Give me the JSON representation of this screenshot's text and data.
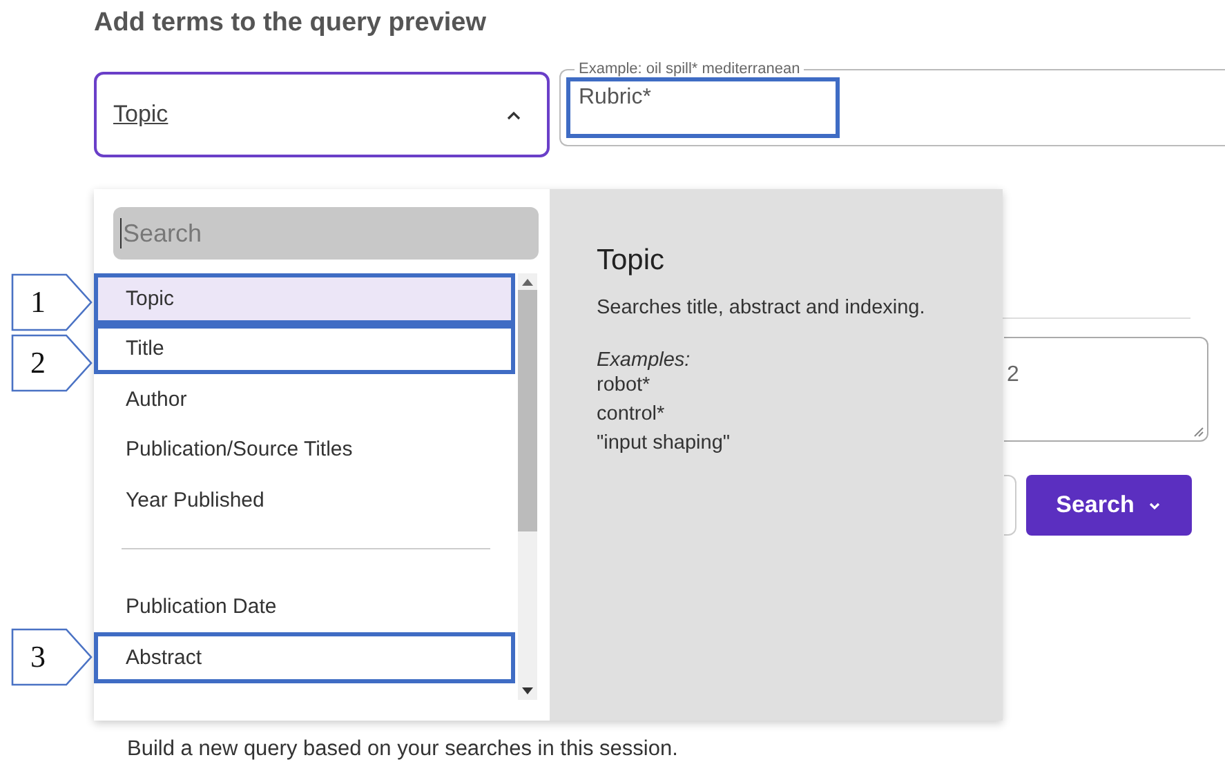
{
  "heading": "Add terms to the query preview",
  "field_select": {
    "label": "Topic",
    "expanded": true
  },
  "query_field": {
    "legend": "Example: oil spill* mediterranean",
    "value": "Rubric*",
    "highlighted": true
  },
  "dropdown": {
    "search": {
      "placeholder": "Search"
    },
    "groups": [
      {
        "items": [
          {
            "label": "Topic",
            "selected": true,
            "highlighted": true
          },
          {
            "label": "Title",
            "selected": false,
            "highlighted": true
          },
          {
            "label": "Author",
            "selected": false,
            "highlighted": false
          },
          {
            "label": "Publication/Source Titles",
            "selected": false,
            "highlighted": false
          },
          {
            "label": "Year Published",
            "selected": false,
            "highlighted": false
          }
        ]
      },
      {
        "items": [
          {
            "label": "Publication Date",
            "selected": false,
            "highlighted": false
          },
          {
            "label": "Abstract",
            "selected": false,
            "highlighted": true
          }
        ]
      }
    ]
  },
  "help": {
    "title": "Topic",
    "description": "Searches title, abstract and indexing.",
    "examples_label": "Examples:",
    "examples": [
      "robot*",
      "control*",
      "\"input shaping\""
    ]
  },
  "query_box": {
    "value": "2"
  },
  "search_button": {
    "label": "Search"
  },
  "footer": "Build a new query based on your searches in this session.",
  "callouts": [
    {
      "label": "1"
    },
    {
      "label": "2"
    },
    {
      "label": "3"
    }
  ]
}
